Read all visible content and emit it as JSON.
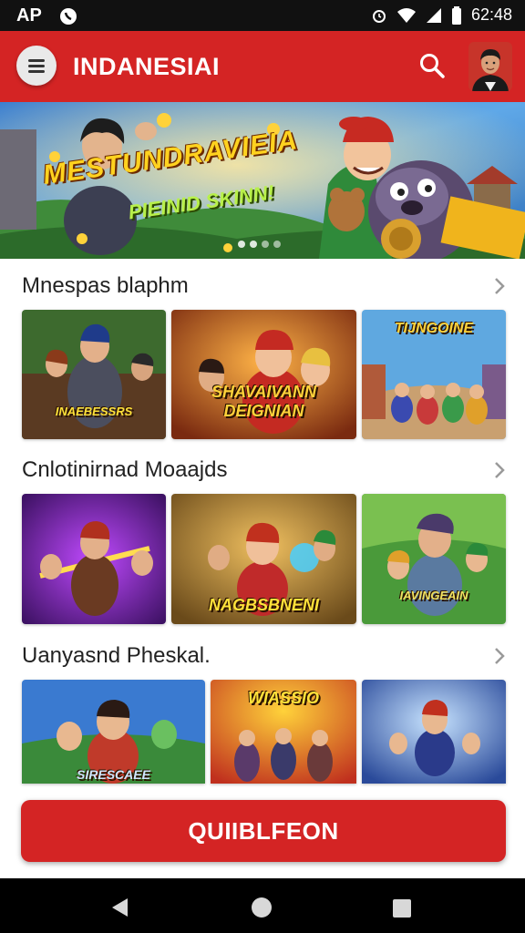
{
  "status_bar": {
    "carrier": "AP",
    "time": "62:48",
    "icons": [
      "whatsapp-icon",
      "alarm-icon",
      "wifi-icon",
      "signal-icon",
      "battery-icon"
    ]
  },
  "app_bar": {
    "title": "INDANESIAI",
    "menu_icon": "menu-icon",
    "search_icon": "search-icon",
    "brand_color": "#d42424"
  },
  "banner": {
    "title": "MESTUNDRAVIEIA",
    "subtitle": "PIEINID SKINN!"
  },
  "sections": [
    {
      "title": "Mnespas blaphm",
      "tiles": [
        {
          "label": "INAEBESSRS"
        },
        {
          "label": "SHAVAIVANN DEIGNIAN"
        },
        {
          "label": "TIJNGOINE"
        }
      ]
    },
    {
      "title": "Cnlotinirnad Moaajds",
      "tiles": [
        {
          "label": ""
        },
        {
          "label": "NAGBSBNENI"
        },
        {
          "label": "IAVINGEAIN"
        }
      ]
    },
    {
      "title": "Uanyasnd Pheskal.",
      "tiles": [
        {
          "label": "SIRESCAEE"
        },
        {
          "label": "WIASSIO"
        },
        {
          "label": ""
        }
      ]
    }
  ],
  "cta_button": {
    "label": "QUIIBLFEON"
  },
  "nav_bar": {
    "icons": [
      "back-icon",
      "home-icon",
      "recents-icon"
    ]
  }
}
